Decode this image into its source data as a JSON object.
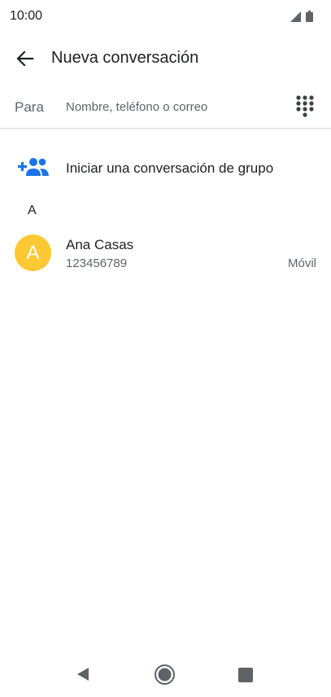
{
  "status_bar": {
    "time": "10:00",
    "icons": [
      "signal-icon",
      "battery-icon"
    ]
  },
  "appbar": {
    "back_icon": "arrow-back-icon",
    "title": "Nueva conversación"
  },
  "to_field": {
    "label": "Para",
    "value": "",
    "placeholder": "Nombre, teléfono o correo",
    "dialpad_icon": "dialpad-icon"
  },
  "group": {
    "icon": "group-add-icon",
    "label": "Iniciar una conversación de grupo"
  },
  "section": {
    "letter": "A"
  },
  "contacts": [
    {
      "initial": "A",
      "name": "Ana Casas",
      "number": "123456789",
      "type": "Móvil"
    }
  ],
  "colors": {
    "accent": "#1a73e8",
    "avatar": "#fcc934",
    "text_primary": "#202124",
    "text_secondary": "#5f6368"
  },
  "nav_bar": {
    "icons": [
      "nav-back-icon",
      "nav-home-icon",
      "nav-recents-icon"
    ]
  }
}
